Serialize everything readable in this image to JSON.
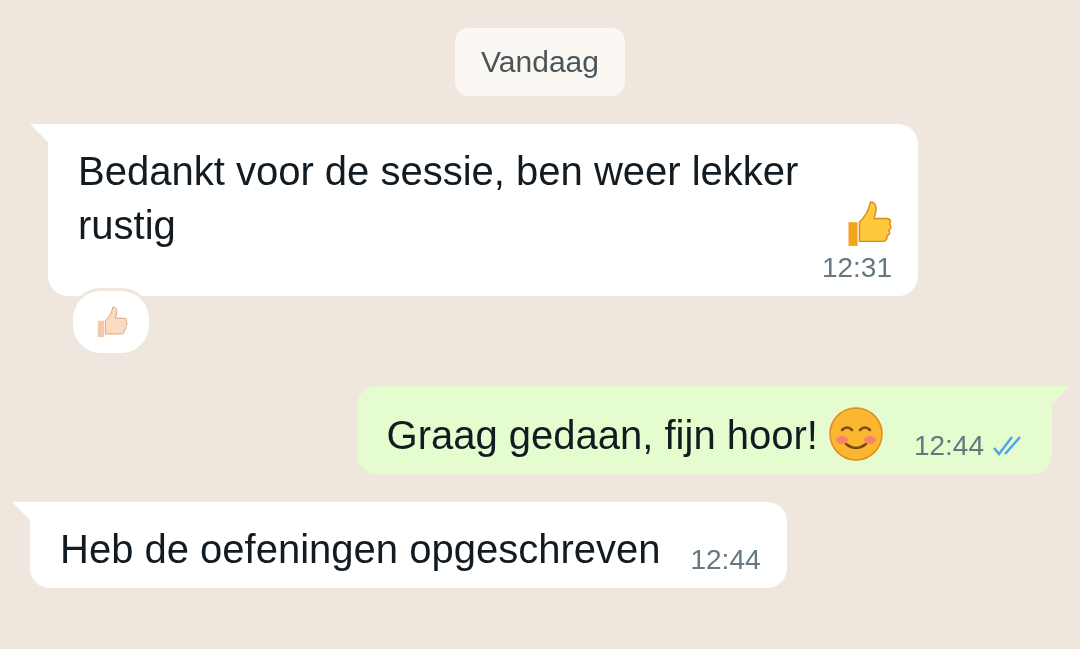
{
  "date_chip": "Vandaag",
  "messages": [
    {
      "kind": "incoming",
      "text": "Bedankt voor de sessie, ben weer lekker rustig",
      "emoji": {
        "kind": "thumbs_up"
      },
      "time": "12:31",
      "reaction": {
        "kind": "thumbs_up_light"
      }
    },
    {
      "kind": "outgoing",
      "text": "Graag gedaan, fijn hoor!",
      "emoji": {
        "kind": "smiling_face"
      },
      "time": "12:44",
      "read": true
    },
    {
      "kind": "incoming",
      "text": "Heb de oefeningen opgeschreven",
      "time": "12:44"
    }
  ]
}
